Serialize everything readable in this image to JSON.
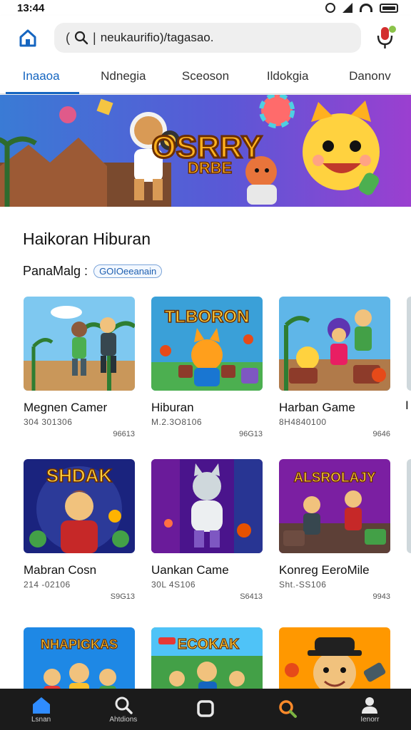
{
  "status": {
    "time": "13:44"
  },
  "search": {
    "value": "neukaurifio)/tagasao."
  },
  "tabs": [
    {
      "label": "Inaaoa",
      "active": true
    },
    {
      "label": "Ndnegia",
      "active": false
    },
    {
      "label": "Sceoson",
      "active": false
    },
    {
      "label": "Ildokgia",
      "active": false
    },
    {
      "label": "Danonv",
      "active": false
    }
  ],
  "banner": {
    "title": "OSRRY",
    "subtitle": "DRBE"
  },
  "section": {
    "title": "Haikoran Hiburan",
    "filter_label": "PanaMalg :",
    "filter_chip": "GOIOeeanain"
  },
  "games": [
    {
      "title": "Megnen Camer",
      "meta": "304 301306",
      "count": "96613",
      "art_text": ""
    },
    {
      "title": "Hiburan",
      "meta": "M.2.3O8106",
      "count": "96G13",
      "art_text": "TLBORON"
    },
    {
      "title": "Harban Game",
      "meta": "8H4840100",
      "count": "9646",
      "art_text": ""
    },
    {
      "title": "Mabran Cosn",
      "meta": "214 -02106",
      "count": "S9G13",
      "art_text": "SHDAK"
    },
    {
      "title": "Uankan Came",
      "meta": "30L 4S106",
      "count": "S6413",
      "art_text": ""
    },
    {
      "title": "Konreg EeroMile",
      "meta": "Sht.-SS106",
      "count": "9943",
      "art_text": "ALSROLAJY"
    },
    {
      "title": "",
      "meta": "",
      "count": "",
      "art_text": "NHAPIGKAS"
    },
    {
      "title": "",
      "meta": "",
      "count": "",
      "art_text": "ECOKAK"
    },
    {
      "title": "",
      "meta": "",
      "count": "",
      "art_text": ""
    }
  ],
  "peek": {
    "row2_title": "I"
  },
  "nav": [
    {
      "label": "Lsnan",
      "icon": "home-icon",
      "color": "#2f8cff"
    },
    {
      "label": "Ahtdions",
      "icon": "search-icon",
      "color": "#e8e8e8"
    },
    {
      "label": "",
      "icon": "square-icon",
      "color": "#e8e8e8"
    },
    {
      "label": "",
      "icon": "search-orange-icon",
      "color": "#ff8a2a"
    },
    {
      "label": "Ienorr",
      "icon": "profile-icon",
      "color": "#e8e8e8"
    }
  ],
  "colors": {
    "accent": "#1565c0",
    "nav_bg": "#1b1b1b",
    "banner_sky": "#3b6fd9",
    "banner_purple": "#8f3fd6"
  }
}
